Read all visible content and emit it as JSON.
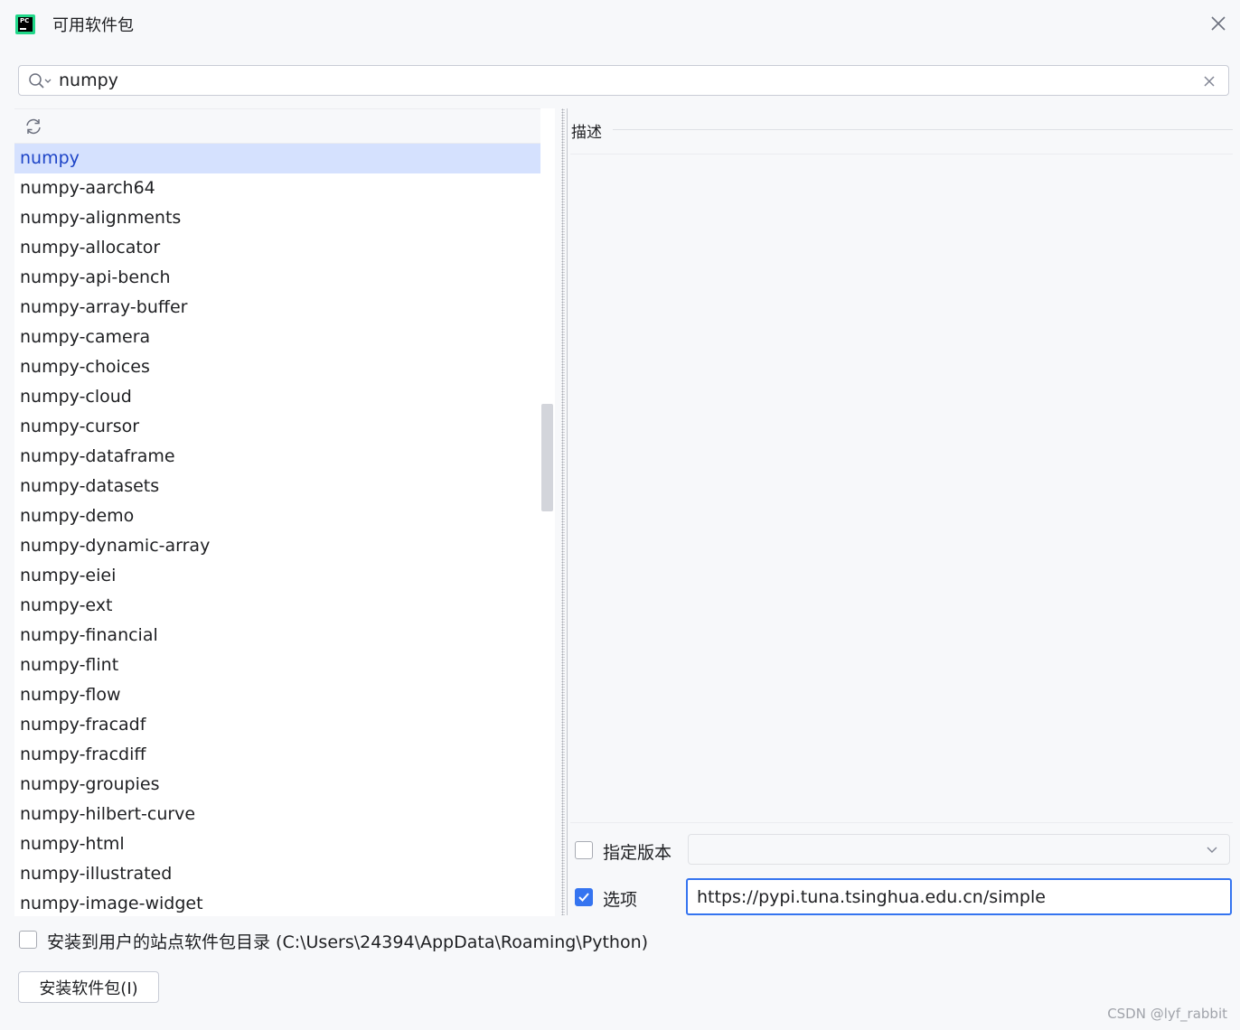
{
  "window": {
    "title": "可用软件包",
    "app_icon_text": "PC"
  },
  "search": {
    "value": "numpy"
  },
  "packages": [
    "numpy",
    "numpy-aarch64",
    "numpy-alignments",
    "numpy-allocator",
    "numpy-api-bench",
    "numpy-array-buffer",
    "numpy-camera",
    "numpy-choices",
    "numpy-cloud",
    "numpy-cursor",
    "numpy-dataframe",
    "numpy-datasets",
    "numpy-demo",
    "numpy-dynamic-array",
    "numpy-eiei",
    "numpy-ext",
    "numpy-financial",
    "numpy-flint",
    "numpy-flow",
    "numpy-fracadf",
    "numpy-fracdiff",
    "numpy-groupies",
    "numpy-hilbert-curve",
    "numpy-html",
    "numpy-illustrated",
    "numpy-image-widget"
  ],
  "selected_index": 0,
  "description": {
    "label": "描述"
  },
  "version": {
    "label": "指定版本",
    "checked": false,
    "selected": ""
  },
  "options": {
    "label": "选项",
    "checked": true,
    "value": "https://pypi.tuna.tsinghua.edu.cn/simple"
  },
  "user_site": {
    "label": "安装到用户的站点软件包目录 (C:\\Users\\24394\\AppData\\Roaming\\Python)",
    "checked": false
  },
  "install_button": {
    "label": "安装软件包(I)"
  },
  "watermark": "CSDN @lyf_rabbit",
  "colors": {
    "accent": "#3574f0",
    "selection_bg": "#d5e1fe",
    "selection_text": "#1d44c7",
    "app_icon_green": "#21d789"
  },
  "icons": {
    "search": "search-icon",
    "clear": "clear-icon",
    "refresh": "refresh-icon",
    "close": "close-icon",
    "chevron": "chevron-down-icon",
    "check": "checkmark-icon"
  }
}
